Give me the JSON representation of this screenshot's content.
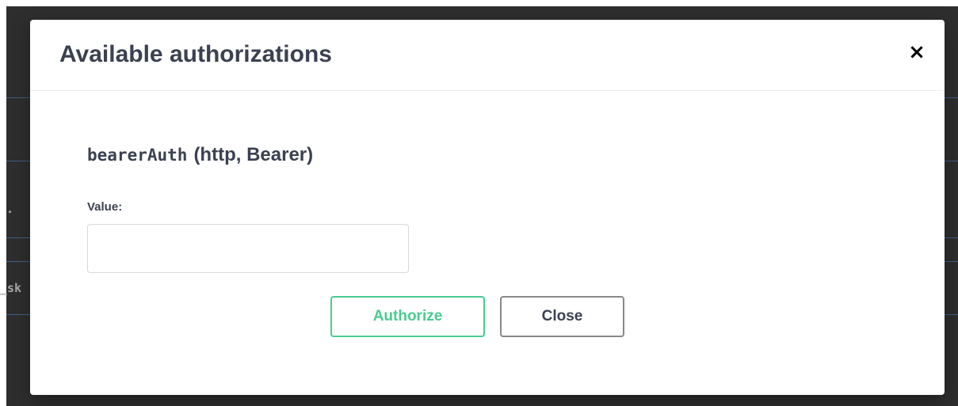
{
  "background": {
    "partial_text_1": ".",
    "partial_text_2": "_sk"
  },
  "modal": {
    "title": "Available authorizations",
    "close_icon": "×",
    "scheme": {
      "name": "bearerAuth",
      "type": "(http, Bearer)"
    },
    "value_label": "Value:",
    "value_input": {
      "value": "",
      "placeholder": ""
    },
    "authorize_label": "Authorize",
    "close_label": "Close"
  },
  "colors": {
    "authorize_accent": "#49cc90",
    "title_text": "#3b4151",
    "overlay": "#2e2e2e"
  }
}
